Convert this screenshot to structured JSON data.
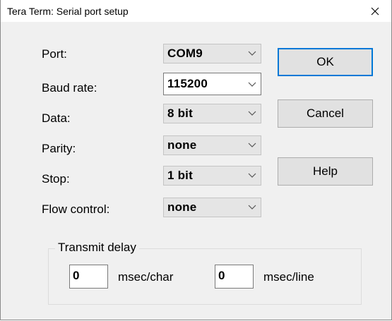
{
  "window": {
    "title": "Tera Term: Serial port setup"
  },
  "fields": {
    "port": {
      "label": "Port:",
      "value": "COM9"
    },
    "baud_rate": {
      "label": "Baud rate:",
      "value": "115200"
    },
    "data": {
      "label": "Data:",
      "value": "8 bit"
    },
    "parity": {
      "label": "Parity:",
      "value": "none"
    },
    "stop": {
      "label": "Stop:",
      "value": "1 bit"
    },
    "flow_control": {
      "label": "Flow control:",
      "value": "none"
    }
  },
  "buttons": {
    "ok": "OK",
    "cancel": "Cancel",
    "help": "Help"
  },
  "transmit_delay": {
    "legend": "Transmit delay",
    "char_value": "0",
    "char_unit": "msec/char",
    "line_value": "0",
    "line_unit": "msec/line"
  },
  "colors": {
    "accent": "#0078d7",
    "dialog_bg": "#f0f0f0"
  },
  "icons": {
    "close": "close-icon",
    "dropdown": "chevron-down-icon"
  }
}
